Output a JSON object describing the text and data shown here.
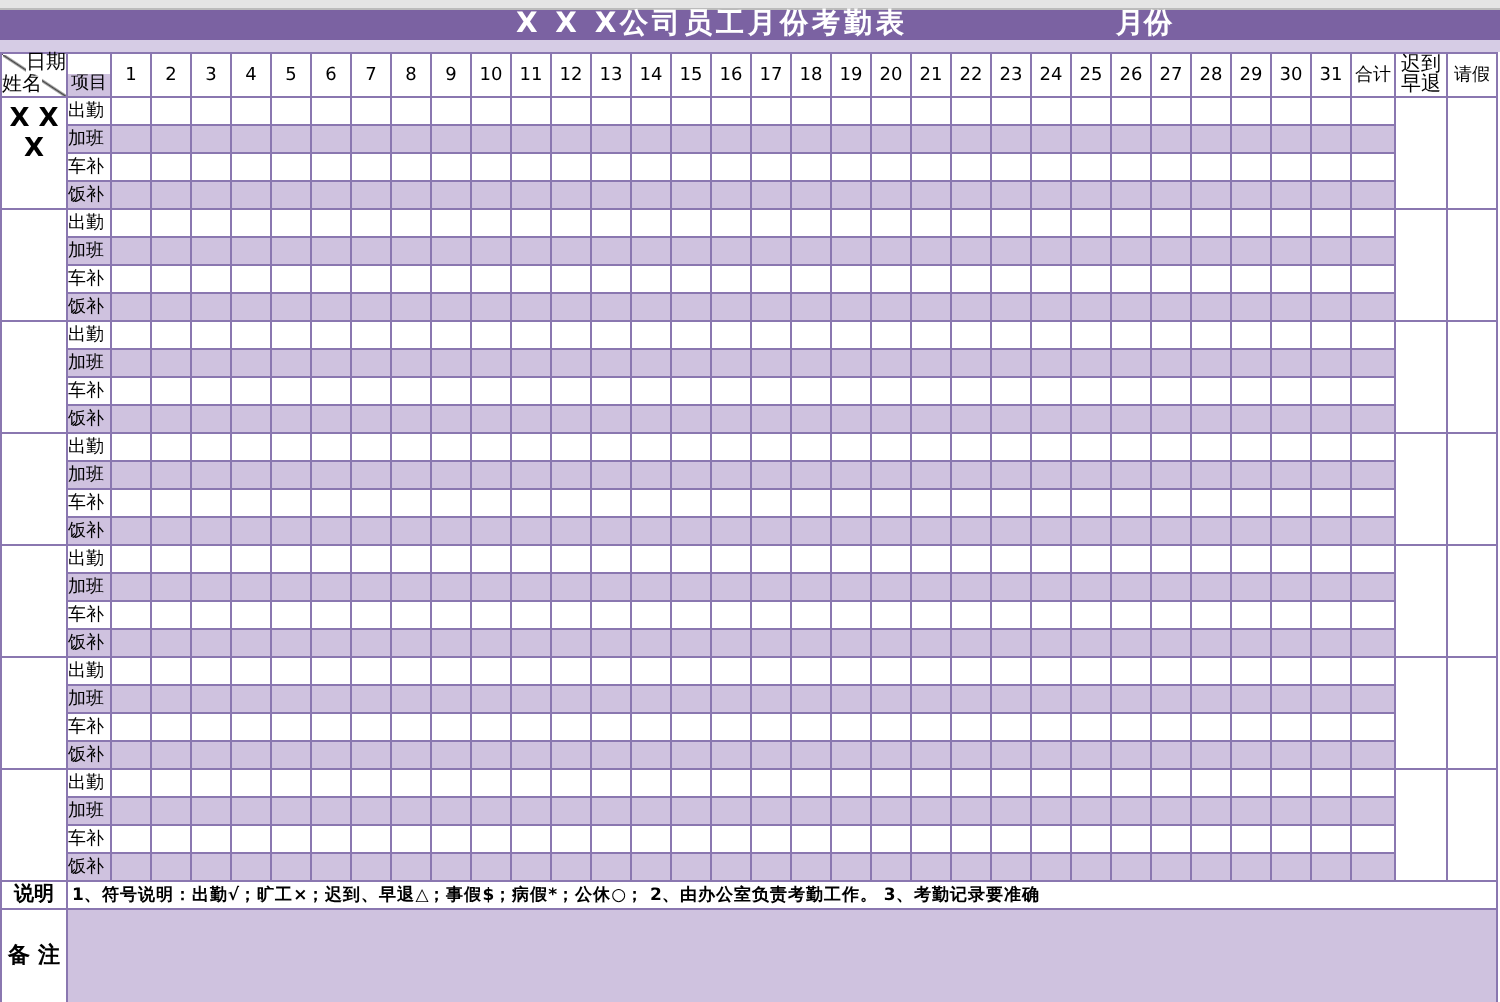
{
  "title": {
    "text": "X X X公司员工月份考勤表",
    "month_label": "月份"
  },
  "header": {
    "date_label": "日期",
    "name_label": "姓名",
    "item_label": "项目",
    "days": [
      "1",
      "2",
      "3",
      "4",
      "5",
      "6",
      "7",
      "8",
      "9",
      "10",
      "11",
      "12",
      "13",
      "14",
      "15",
      "16",
      "17",
      "18",
      "19",
      "20",
      "21",
      "22",
      "23",
      "24",
      "25",
      "26",
      "27",
      "28",
      "29",
      "30",
      "31"
    ],
    "total_label": "合计",
    "late_label": "迟到早退",
    "leave_label": "请假"
  },
  "employees": [
    {
      "name": "X X X",
      "rows": [
        "出勤",
        "加班",
        "车补",
        "饭补"
      ]
    },
    {
      "rows": [
        "出勤",
        "加班",
        "车补",
        "饭补"
      ]
    },
    {
      "rows": [
        "出勤",
        "加班",
        "车补",
        "饭补"
      ]
    },
    {
      "rows": [
        "出勤",
        "加班",
        "车补",
        "饭补"
      ]
    },
    {
      "rows": [
        "出勤",
        "加班",
        "车补",
        "饭补"
      ]
    },
    {
      "rows": [
        "出勤",
        "加班",
        "车补",
        "饭补"
      ]
    },
    {
      "rows": [
        "出勤",
        "加班",
        "车补",
        "饭补"
      ]
    }
  ],
  "notes": {
    "label": "说明",
    "text": "1、符号说明：出勤√；旷工×；迟到、早退△；事假$；病假*；公休○；   2、由办公室负责考勤工作。  3、考勤记录要准确"
  },
  "remarks": {
    "label": "备 注"
  }
}
